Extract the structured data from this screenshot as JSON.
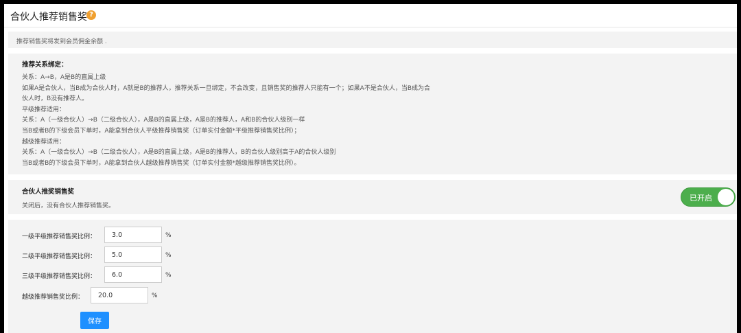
{
  "header": {
    "title": "合伙人推荐销售奖",
    "help_icon": "question-icon",
    "help_glyph": "?"
  },
  "notice": "推荐销售奖将发到会员佣金余额 .",
  "rules": {
    "title": "推荐关系绑定：",
    "lines": [
      "关系：A→B，A是B的直属上级",
      "如果A是合伙人，当B成为合伙人时，A就是B的推荐人，推荐关系一旦绑定，不会改变，且销售奖的推荐人只能有一个；如果A不是合伙人，当B成为合",
      "伙人时，B没有推荐人。",
      "平级推荐适用：",
      "关系：A（一级合伙人）→B（二级合伙人），A是B的直属上级，A是B的推荐人，A和B的合伙人级别一样",
      "当B或者B的下级会员下单时，A能拿到合伙人平级推荐销售奖（订单实付金额*平级推荐销售奖比例）；",
      "越级推荐适用：",
      "关系：A（一级合伙人）→B（二级合伙人），A是B的直属上级，A是B的推荐人，B的合伙人级别高于A的合伙人级别",
      "当B或者B的下级会员下单时，A能拿到合伙人越级推荐销售奖（订单实付金额*越级推荐销售奖比例）。"
    ]
  },
  "toggle_section": {
    "title": "合伙人推奖销售奖",
    "description": "关闭后，没有合伙人推荐销售奖。",
    "switch_label": "已开启",
    "enabled": true,
    "color": "#4cae4c"
  },
  "rates": [
    {
      "label": "一级平级推荐销售奖比例：",
      "value": "3.0",
      "unit": "%"
    },
    {
      "label": "二级平级推荐销售奖比例：",
      "value": "5.0",
      "unit": "%"
    },
    {
      "label": "三级平级推荐销售奖比例：",
      "value": "6.0",
      "unit": "%"
    },
    {
      "label": "越级推荐销售奖比例：",
      "value": "20.0",
      "unit": "%"
    }
  ],
  "save_label": "保存",
  "accent_color": "#1e90ff"
}
